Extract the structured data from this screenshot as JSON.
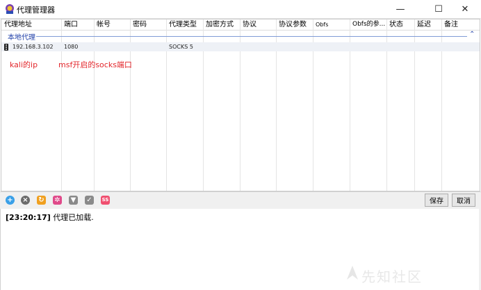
{
  "window": {
    "title": "代理管理器",
    "minimize_glyph": "—",
    "maximize_glyph": "☐",
    "close_glyph": "✕"
  },
  "grid": {
    "columns": [
      "代理地址",
      "端口",
      "帐号",
      "密码",
      "代理类型",
      "加密方式",
      "协议",
      "协议参数",
      "Obfs",
      "Obfs的参...",
      "状态",
      "延迟",
      "备注"
    ],
    "group": {
      "label": "本地代理",
      "chevron": "⌃"
    },
    "rows": [
      {
        "address": "192.168.3.102",
        "port": "1080",
        "account": "",
        "password": "",
        "type": "SOCKS 5",
        "encryption": "",
        "protocol": "",
        "protocol_params": "",
        "obfs": "",
        "obfs_params": "",
        "status": "",
        "latency": "",
        "note": ""
      }
    ]
  },
  "annotations": {
    "ip_note": "kali的ip",
    "port_note": "msf开启的socks端口"
  },
  "toolbar": {
    "icons": [
      "add-icon",
      "remove-icon",
      "refresh-icon",
      "settings-icon",
      "shield-icon",
      "check-icon",
      "ss-icon"
    ],
    "icon_colors": [
      "#3aa0e8",
      "#6b6b6b",
      "#f0a020",
      "#e04a8a",
      "#8a8a8a",
      "#8a8a8a",
      "#f05070"
    ],
    "save_label": "保存",
    "cancel_label": "取消"
  },
  "log": {
    "time": "[23:20:17]",
    "message": "代理已加载."
  },
  "watermark": {
    "text": "先知社区"
  }
}
